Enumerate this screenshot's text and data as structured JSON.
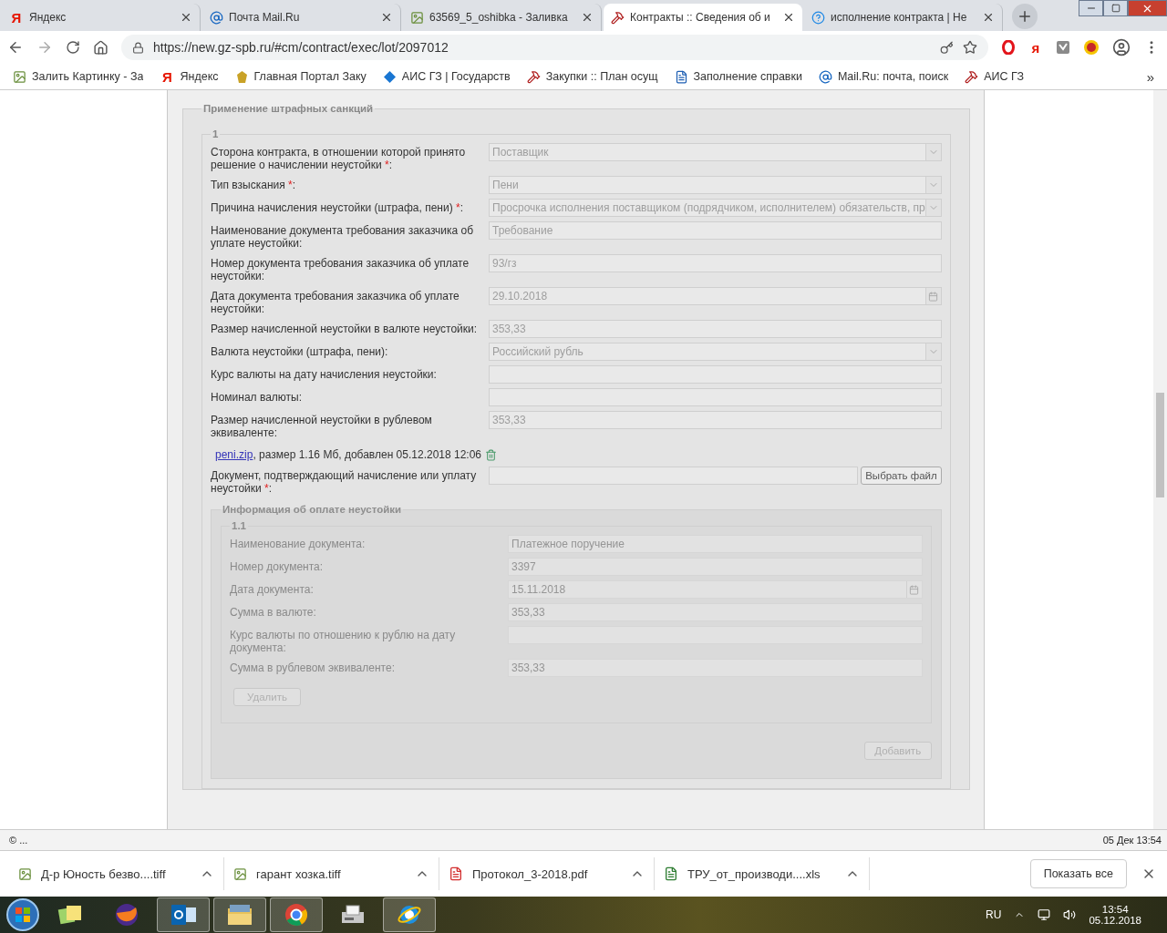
{
  "tabs": [
    {
      "title": "Яндекс",
      "kind": "glyph",
      "glyph": "Я",
      "selected": false
    },
    {
      "title": "Почта Mail.Ru",
      "kind": "mail",
      "selected": false
    },
    {
      "title": "63569_5_oshibka - Заливка",
      "kind": "image",
      "selected": false
    },
    {
      "title": "Контракты :: Сведения об и",
      "kind": "tools",
      "selected": true
    },
    {
      "title": "исполнение контракта | Не",
      "kind": "help",
      "selected": false
    }
  ],
  "address": {
    "url": "https://new.gz-spb.ru/#cm/contract/exec/lot/2097012",
    "ext_glyph": "я"
  },
  "bookmarks": [
    {
      "title": "Залить Картинку - За",
      "kind": "image"
    },
    {
      "title": "Яндекс",
      "kind": "glyph",
      "glyph": "Я"
    },
    {
      "title": "Главная Портал Заку",
      "kind": "emblem"
    },
    {
      "title": "АИС ГЗ | Государств",
      "kind": "diamond"
    },
    {
      "title": "Закупки :: План осущ",
      "kind": "tools"
    },
    {
      "title": "Заполнение справки",
      "kind": "doc"
    },
    {
      "title": "Mail.Ru: почта, поиск",
      "kind": "mail"
    },
    {
      "title": "АИС ГЗ",
      "kind": "tools"
    }
  ],
  "bookmarks_overflow": "»",
  "form": {
    "title": "Применение штрафных санкций",
    "group": "1",
    "fields": [
      {
        "label": "Сторона контракта, в отношении которой принято решение о начислении неустойки ",
        "required_mark": "*",
        "label_end": ":",
        "kind": "select",
        "value": "Поставщик"
      },
      {
        "label": "Тип взыскания ",
        "required_mark": "*",
        "label_end": ":",
        "kind": "select",
        "value": "Пени"
      },
      {
        "label": "Причина начисления неустойки (штрафа, пени) ",
        "required_mark": "*",
        "label_end": ":",
        "kind": "select",
        "value": "Просрочка исполнения поставщиком (подрядчиком, исполнителем) обязательств, пр"
      },
      {
        "label": "Наименование документа требования заказчика об уплате неустойки:",
        "kind": "text",
        "value": "Требование"
      },
      {
        "label": "Номер документа требования заказчика об уплате неустойки:",
        "kind": "text",
        "value": "93/гз"
      },
      {
        "label": "Дата документа требования заказчика об уплате неустойки:",
        "kind": "date",
        "value": "29.10.2018"
      },
      {
        "label": "Размер начисленной неустойки в валюте неустойки:",
        "kind": "text",
        "value": "353,33"
      },
      {
        "label": "Валюта неустойки (штрафа, пени):",
        "kind": "select",
        "value": "Российский рубль"
      },
      {
        "label": "Курс валюты на дату начисления неустойки:",
        "kind": "text"
      },
      {
        "label": "Номинал валюты:",
        "kind": "text"
      },
      {
        "label": "Размер начисленной неустойки в рублевом эквиваленте:",
        "kind": "text",
        "value": "353,33"
      }
    ],
    "attachment": {
      "file": "peni.zip",
      "details": ", размер 1.16 Мб, добавлен 05.12.2018 12:06"
    },
    "upload": {
      "label": "Документ, подтверждающий начисление или уплату неустойки ",
      "required_mark": "*",
      "label_end": ":",
      "button": "Выбрать файл"
    },
    "payment": {
      "title": "Информация об оплате неустойки",
      "group": "1.1",
      "disabled": true,
      "fields": [
        {
          "label": "Наименование документа:",
          "kind": "text",
          "value": "Платежное поручение"
        },
        {
          "label": "Номер документа:",
          "kind": "text",
          "value": "3397"
        },
        {
          "label": "Дата документа:",
          "kind": "date",
          "value": "15.11.2018"
        },
        {
          "label": "Сумма в валюте:",
          "kind": "text",
          "value": "353,33"
        },
        {
          "label": "Курс валюты по отношению к рублю на дату документа:",
          "kind": "text"
        },
        {
          "label": "Сумма в рублевом эквиваленте:",
          "kind": "text",
          "value": "353,33"
        }
      ],
      "delete_button": "Удалить",
      "add_button": "Добавить"
    }
  },
  "page_status": {
    "left": "© ...",
    "right": "05 Дек 13:54"
  },
  "downloads": [
    {
      "name": "Д-р Юность безво....tiff",
      "kind": "image"
    },
    {
      "name": "гарант хозка.tiff",
      "kind": "image"
    },
    {
      "name": "Протокол_3-2018.pdf",
      "kind": "pdf"
    },
    {
      "name": "ТРУ_от_производи....xls",
      "kind": "xls"
    }
  ],
  "show_all": "Показать все",
  "taskbar": {
    "apps": [
      {
        "kind": "notes",
        "active": false
      },
      {
        "kind": "firefox",
        "active": false
      },
      {
        "kind": "outlook",
        "active": true
      },
      {
        "kind": "folder",
        "active": true
      },
      {
        "kind": "chrome",
        "active": true
      },
      {
        "kind": "fax",
        "active": false
      },
      {
        "kind": "ie",
        "active": true
      }
    ],
    "lang": "RU",
    "time": "13:54",
    "date": "05.12.2018"
  }
}
